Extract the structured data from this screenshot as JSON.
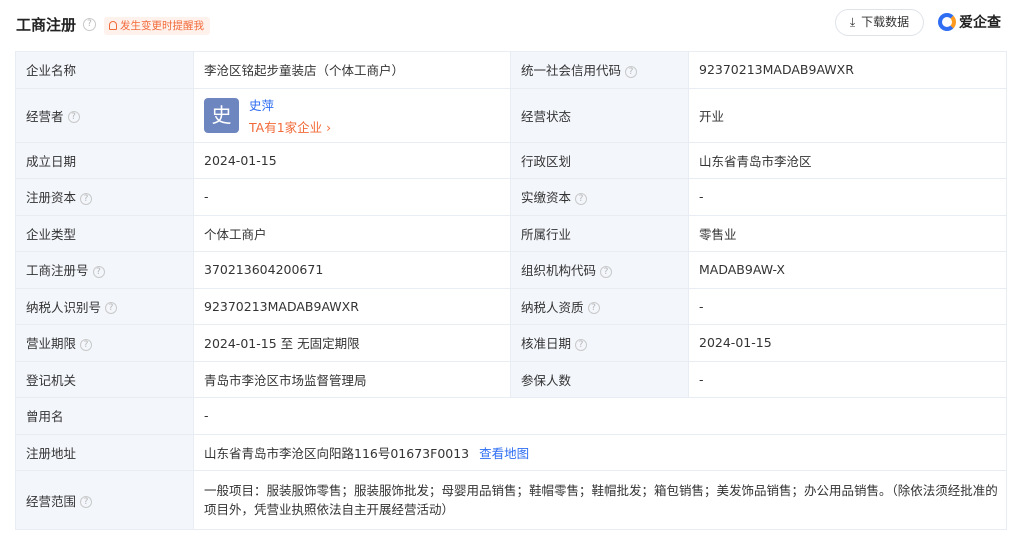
{
  "header": {
    "title": "工商注册",
    "remind_label": "发生变更时提醒我",
    "download_label": "下载数据",
    "brand": "爱企查"
  },
  "rows": {
    "company_name": {
      "label": "企业名称",
      "value": "李沧区铭起步童装店（个体工商户）"
    },
    "credit_code": {
      "label": "统一社会信用代码",
      "value": "92370213MADAB9AWXR"
    },
    "operator": {
      "label": "经营者",
      "avatar_char": "史",
      "name": "史萍",
      "companies": "TA有1家企业 ›"
    },
    "status": {
      "label": "经营状态",
      "value": "开业"
    },
    "founded": {
      "label": "成立日期",
      "value": "2024-01-15"
    },
    "region": {
      "label": "行政区划",
      "value": "山东省青岛市李沧区"
    },
    "reg_capital": {
      "label": "注册资本",
      "value": "-"
    },
    "paid_capital": {
      "label": "实缴资本",
      "value": "-"
    },
    "company_type": {
      "label": "企业类型",
      "value": "个体工商户"
    },
    "industry": {
      "label": "所属行业",
      "value": "零售业"
    },
    "reg_number": {
      "label": "工商注册号",
      "value": "370213604200671"
    },
    "org_code": {
      "label": "组织机构代码",
      "value": "MADAB9AW-X"
    },
    "taxpayer_id": {
      "label": "纳税人识别号",
      "value": "92370213MADAB9AWXR"
    },
    "taxpayer_qual": {
      "label": "纳税人资质",
      "value": "-"
    },
    "term": {
      "label": "营业期限",
      "value": "2024-01-15 至 无固定期限"
    },
    "approval_date": {
      "label": "核准日期",
      "value": "2024-01-15"
    },
    "authority": {
      "label": "登记机关",
      "value": "青岛市李沧区市场监督管理局"
    },
    "insured": {
      "label": "参保人数",
      "value": "-"
    },
    "former_name": {
      "label": "曾用名",
      "value": "-"
    },
    "address": {
      "label": "注册地址",
      "value": "山东省青岛市李沧区向阳路116号01673F0013",
      "map_link": "查看地图"
    },
    "scope": {
      "label": "经营范围",
      "value": "一般项目：服装服饰零售；服装服饰批发；母婴用品销售；鞋帽零售；鞋帽批发；箱包销售；美发饰品销售；办公用品销售。（除依法须经批准的项目外，凭营业执照依法自主开展经营活动）"
    }
  },
  "colors": {
    "link": "#2f6ef2",
    "accent": "#f26b3a",
    "label_bg": "#f3f6fb",
    "border": "#e8edf3"
  },
  "icons": [
    "help-icon",
    "bell-icon",
    "download-icon",
    "brand-logo-icon"
  ]
}
